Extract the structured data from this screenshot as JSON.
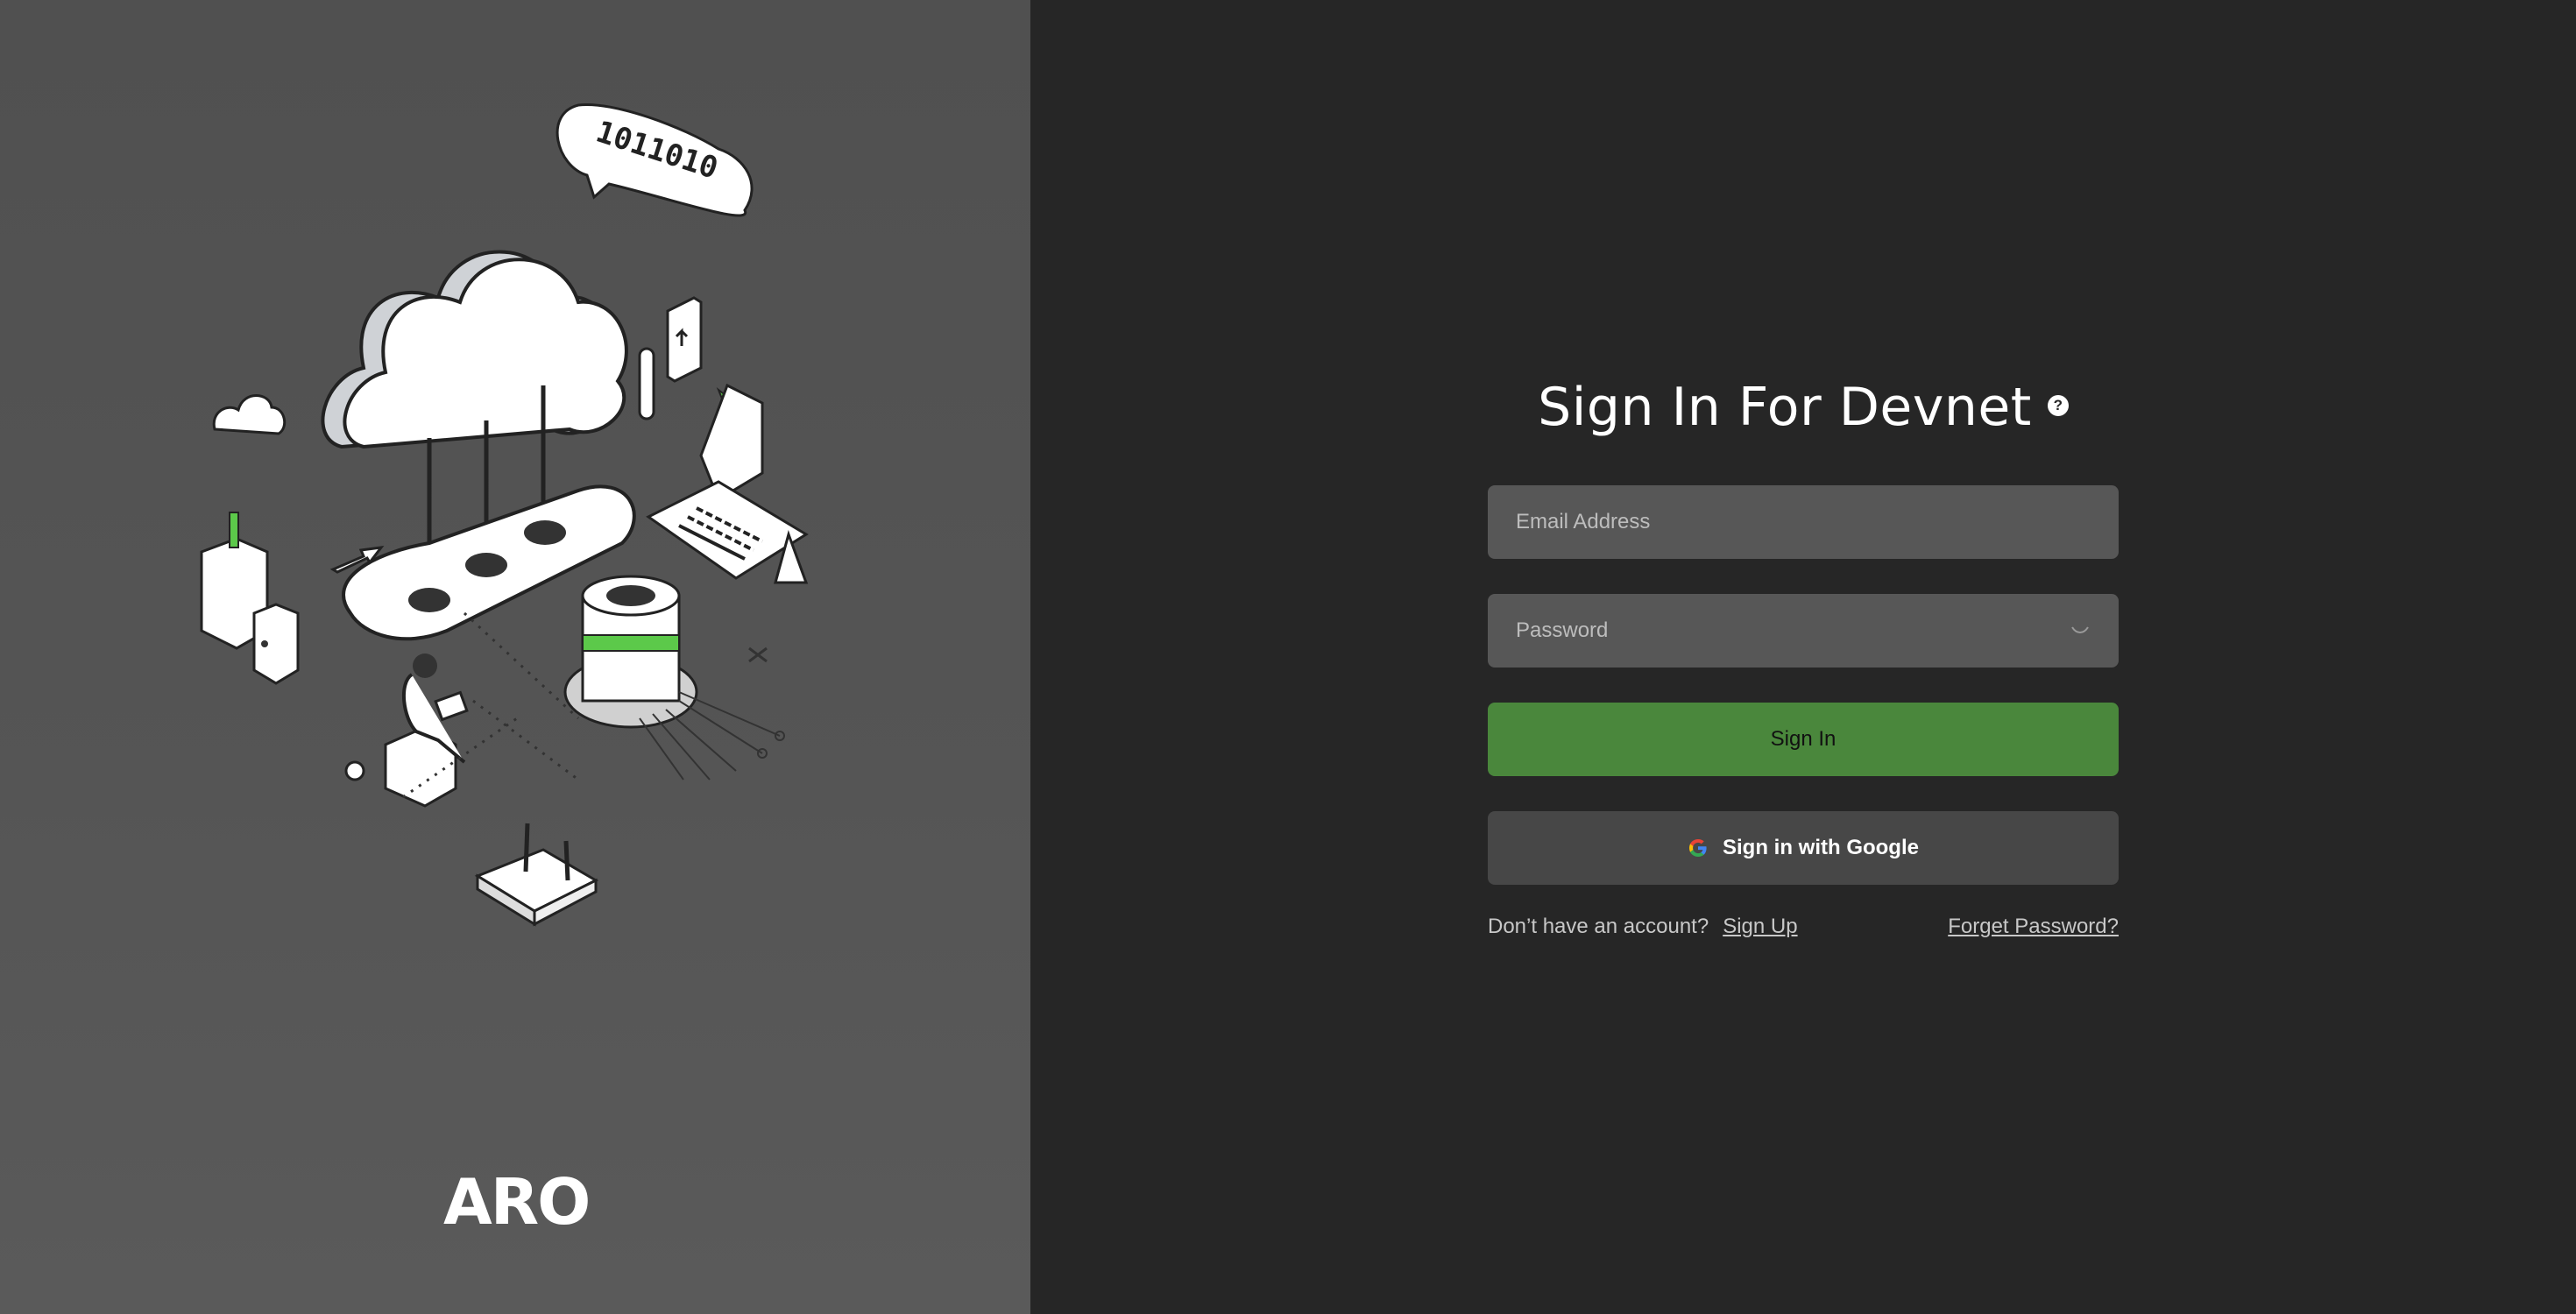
{
  "brand": {
    "logo_text": "ARO"
  },
  "illustration": {
    "bubble_text": "1011010"
  },
  "form": {
    "title": "Sign In For Devnet",
    "help_icon": "?",
    "email": {
      "placeholder": "Email Address",
      "value": ""
    },
    "password": {
      "placeholder": "Password",
      "value": ""
    },
    "sign_in_label": "Sign In",
    "google_label": "Sign in with Google",
    "no_account_text": "Don’t have an account?",
    "sign_up_label": "Sign Up",
    "forgot_label": "Forget Password?"
  },
  "colors": {
    "accent_green": "#4a873c",
    "illustration_green": "#5cc94a",
    "left_bg": "#555555",
    "right_bg": "#262626",
    "input_bg": "#575757"
  },
  "icons": [
    "help-icon",
    "eye-off-icon",
    "google-icon"
  ]
}
